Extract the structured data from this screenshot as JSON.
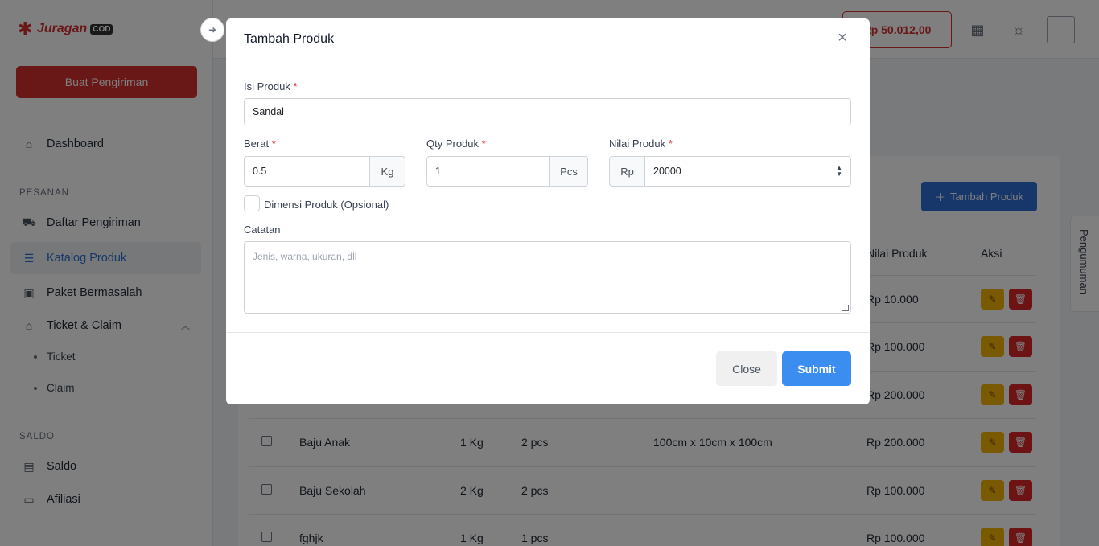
{
  "brand": {
    "name": "Juragan",
    "suffix": "COD"
  },
  "sidebar": {
    "create_button": "Buat Pengiriman",
    "dashboard": "Dashboard",
    "section_pesanan": "PESANAN",
    "items": [
      {
        "label": "Daftar Pengiriman"
      },
      {
        "label": "Katalog Produk"
      },
      {
        "label": "Paket Bermasalah"
      },
      {
        "label": "Ticket & Claim"
      }
    ],
    "sub_items": [
      {
        "label": "Ticket"
      },
      {
        "label": "Claim"
      }
    ],
    "section_saldo": "SALDO",
    "saldo_items": [
      {
        "label": "Saldo"
      },
      {
        "label": "Afiliasi"
      }
    ]
  },
  "topbar": {
    "balance": "Rp 50.012,00"
  },
  "main": {
    "add_button": "Tambah Produk",
    "announcement_tab": "Pengumuman",
    "columns": {
      "value": "Nilai Produk",
      "action": "Aksi"
    },
    "rows": [
      {
        "name": "",
        "weight": "",
        "qty": "",
        "dims": "",
        "value": "Rp 10.000"
      },
      {
        "name": "",
        "weight": "",
        "qty": "",
        "dims": "",
        "value": "Rp 100.000"
      },
      {
        "name": "",
        "weight": "",
        "qty": "",
        "dims": "",
        "value": "Rp 200.000"
      },
      {
        "name": "Baju Anak",
        "weight": "1 Kg",
        "qty": "2 pcs",
        "dims": "100cm x 10cm x 100cm",
        "value": "Rp 200.000"
      },
      {
        "name": "Baju Sekolah",
        "weight": "2 Kg",
        "qty": "2 pcs",
        "dims": "",
        "value": "Rp 100.000"
      },
      {
        "name": "fghjk",
        "weight": "1 Kg",
        "qty": "1 pcs",
        "dims": "",
        "value": "Rp 100.000"
      }
    ]
  },
  "modal": {
    "title": "Tambah Produk",
    "close_icon": "×",
    "isi_label": "Isi Produk",
    "isi_value": "Sandal",
    "berat_label": "Berat",
    "berat_value": "0.5",
    "berat_unit": "Kg",
    "qty_label": "Qty Produk",
    "qty_value": "1",
    "qty_unit": "Pcs",
    "nilai_label": "Nilai Produk",
    "nilai_prefix": "Rp",
    "nilai_value": "20000",
    "dimensi_label": "Dimensi Produk (Opsional)",
    "catatan_label": "Catatan",
    "catatan_placeholder": "Jenis, warna, ukuran, dll",
    "close_button": "Close",
    "submit_button": "Submit",
    "required_mark": "*"
  },
  "colors": {
    "brand_red": "#d32f2f",
    "primary_blue": "#2f6fd6",
    "submit_blue": "#3b8ef0",
    "edit_yellow": "#f5b400",
    "delete_red": "#dc2626"
  }
}
